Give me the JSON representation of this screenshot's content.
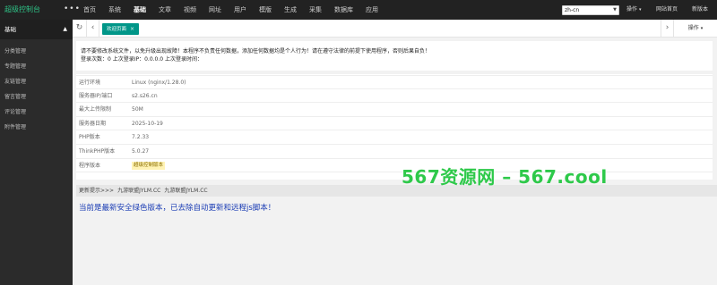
{
  "brand": "超级控制台",
  "dots": "•••",
  "top_nav": [
    "首页",
    "系统",
    "基础",
    "文章",
    "视频",
    "网址",
    "用户",
    "模版",
    "生成",
    "采集",
    "数据库",
    "应用"
  ],
  "top_nav_active": "基础",
  "lang_select": "zh-cn",
  "top_right": {
    "ops": "操作",
    "caret": "▾",
    "home": "网站首页",
    "newver": "新版本"
  },
  "sidebar": {
    "header": "基础",
    "items": [
      "分类管理",
      "专题管理",
      "友链管理",
      "留言管理",
      "评论管理",
      "附件管理"
    ]
  },
  "tabbar": {
    "active_tab": "欢迎页面",
    "close": "×",
    "ops": "操作",
    "caret": "▾"
  },
  "notice": {
    "line1": "请不要修改系统文件，以免升级出现故障！本程序不负责任何数据，添加任何数据均是个人行为！请在遵守法律的前提下使用程序，否则后果自负！",
    "line2": "登录次数：0 上次登录IP：0.0.0.0 上次登录时间："
  },
  "info_rows": [
    {
      "label": "运行环境",
      "value": "Linux (nginx/1.28.0)"
    },
    {
      "label": "服务器IP/端口",
      "value": "s2.s26.cn"
    },
    {
      "label": "最大上传限制",
      "value": "50M"
    },
    {
      "label": "服务器日期",
      "value": "2025-10-19"
    },
    {
      "label": "PHP版本",
      "value": "7.2.33"
    },
    {
      "label": "ThinkPHP版本",
      "value": "5.0.27"
    },
    {
      "label": "程序版本",
      "value": "超级控制版本"
    }
  ],
  "update": {
    "label": "更新提示>>>",
    "link1": "九游联盟JYLM.CC",
    "link2": "九游联盟JYLM.CC",
    "message": "当前是最新安全绿色版本，已去除自动更新和远程js脚本！"
  },
  "watermark": "567资源网 – 567.cool",
  "colors": {
    "topbar": "#222222",
    "sidebar": "#2b2b2b",
    "accent": "#009688",
    "brand": "#2ec286",
    "update_msg": "#1a3cb4",
    "watermark": "#2ec94a"
  }
}
